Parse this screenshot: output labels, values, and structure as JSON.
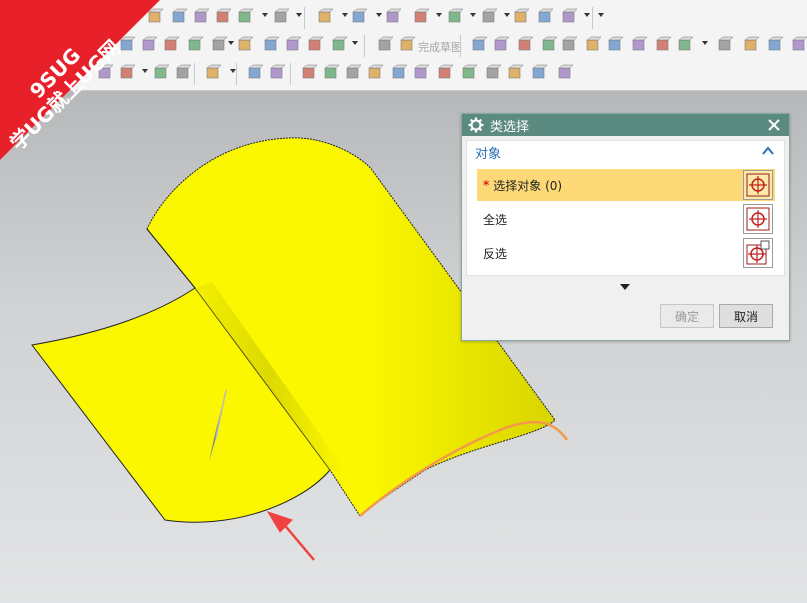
{
  "toolbar": {
    "sketch_done_label": "完成草图"
  },
  "badge": {
    "brand_line1": "9SUG",
    "brand_line2": "学UG就上UG网",
    "color": "#e8202a"
  },
  "dialog": {
    "title": "类选择",
    "group_title": "对象",
    "rows": [
      {
        "label": "选择对象 (0)",
        "required": "*"
      },
      {
        "label": "全选"
      },
      {
        "label": "反选"
      }
    ],
    "ok_label": "确定",
    "cancel_label": "取消",
    "accent": "#5b8a80",
    "highlight": "#fdd877"
  },
  "model": {
    "surface_color": "#fbf700",
    "edge_highlight_color": "#f39a4a",
    "arrow_color": "#f0403f"
  }
}
